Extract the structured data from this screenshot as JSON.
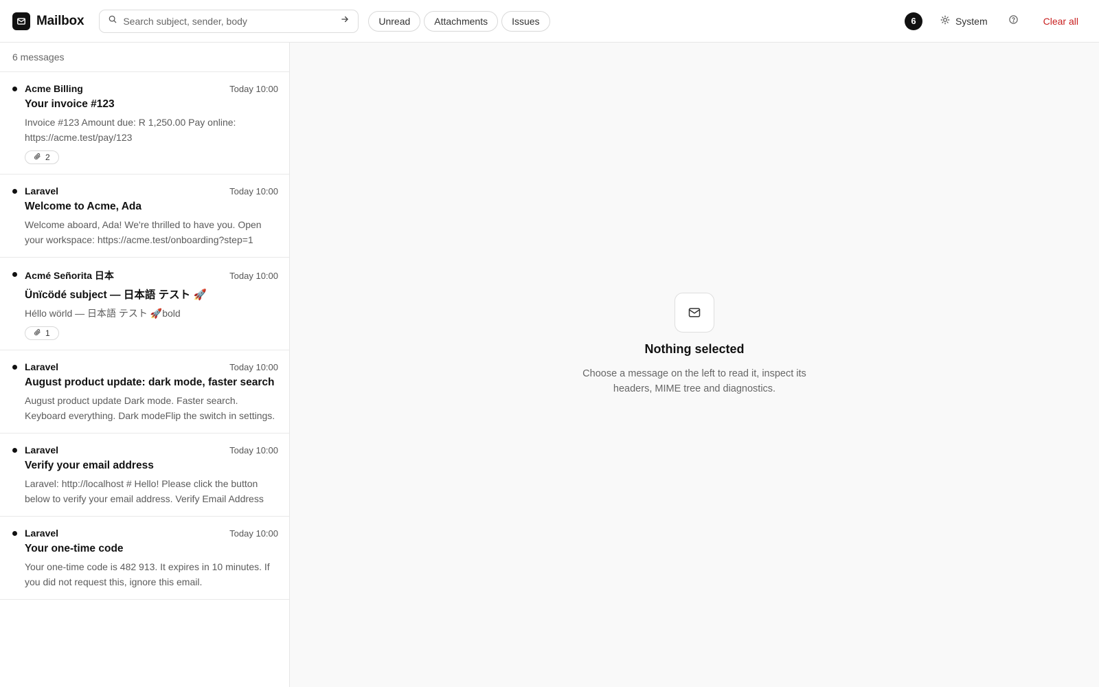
{
  "app": {
    "title": "Mailbox"
  },
  "search": {
    "placeholder": "Search subject, sender, body"
  },
  "filters": [
    "Unread",
    "Attachments",
    "Issues"
  ],
  "header": {
    "count": "6",
    "theme_label": "System",
    "clear_label": "Clear all"
  },
  "list": {
    "summary": "6 messages",
    "messages": [
      {
        "sender": "Acme Billing",
        "time": "Today 10:00",
        "subject": "Your invoice #123",
        "preview": "Invoice #123 Amount due: R 1,250.00 Pay online: https://acme.test/pay/123",
        "attachments": "2",
        "unread": true
      },
      {
        "sender": "Laravel",
        "time": "Today 10:00",
        "subject": "Welcome to Acme, Ada",
        "preview": "Welcome aboard, Ada! We're thrilled to have you. Open your workspace: https://acme.test/onboarding?step=1",
        "attachments": null,
        "unread": true
      },
      {
        "sender": "Acmé Señorita 日本",
        "time": "Today 10:00",
        "subject": "Ünïcödé subject — 日本語 テスト 🚀",
        "preview": "Héllo wörld — 日本語 テスト 🚀bold",
        "attachments": "1",
        "unread": true
      },
      {
        "sender": "Laravel",
        "time": "Today 10:00",
        "subject": "August product update: dark mode, faster search",
        "preview": "August product update Dark mode. Faster search. Keyboard everything. Dark modeFlip the switch in settings.",
        "attachments": null,
        "unread": true
      },
      {
        "sender": "Laravel",
        "time": "Today 10:00",
        "subject": "Verify your email address",
        "preview": "Laravel: http://localhost # Hello! Please click the button below to verify your email address. Verify Email Address",
        "attachments": null,
        "unread": true
      },
      {
        "sender": "Laravel",
        "time": "Today 10:00",
        "subject": "Your one-time code",
        "preview": "Your one-time code is 482 913. It expires in 10 minutes. If you did not request this, ignore this email.",
        "attachments": null,
        "unread": true
      }
    ]
  },
  "empty": {
    "title": "Nothing selected",
    "description": "Choose a message on the left to read it, inspect its headers, MIME tree and diagnostics."
  },
  "colors": {
    "accent": "#111111",
    "danger": "#c81e1e",
    "panel_bg": "#f9f9f9"
  },
  "icons": {
    "logo": "envelope-icon",
    "search": "search-icon",
    "submit": "arrow-right-icon",
    "theme": "sun-icon",
    "help": "help-circle-icon",
    "attachment": "paperclip-icon",
    "empty": "envelope-icon"
  }
}
